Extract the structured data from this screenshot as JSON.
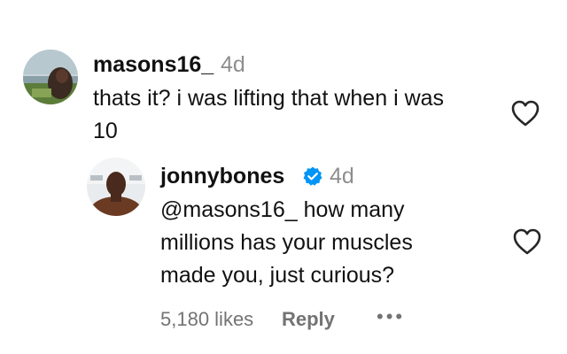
{
  "comment": {
    "username": "masons16_",
    "time": "4d",
    "text_line1": "thats it? i was lifting that when i was",
    "text_line2": "10",
    "avatar_icon": "profile-photo",
    "like_icon": "heart-outline-icon"
  },
  "reply": {
    "username": "jonnybones",
    "verified_icon": "verified-badge-icon",
    "time": "4d",
    "mention": "@masons16_",
    "text_line1_rest": " how many",
    "text_line2": "millions has your muscles",
    "text_line3": "made you, just curious?",
    "likes": "5,180 likes",
    "reply_label": "Reply",
    "more_label": "•••",
    "avatar_icon": "profile-photo",
    "like_icon": "heart-outline-icon"
  },
  "colors": {
    "text": "#111111",
    "secondary": "#8e8e8e",
    "meta": "#737373",
    "verified": "#0095f6"
  }
}
